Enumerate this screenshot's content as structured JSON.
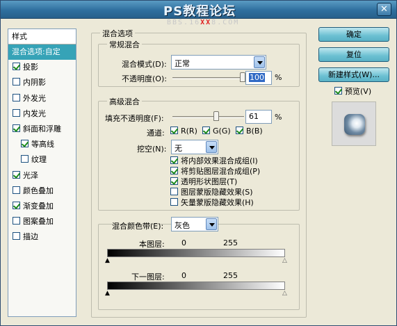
{
  "window": {
    "title": "PS教程论坛",
    "subtitle_pre": "BBS.16",
    "subtitle_red": "XX",
    "subtitle_post": "8.COM",
    "close": "✕"
  },
  "styles": {
    "header": "样式",
    "items": [
      {
        "label": "混合选项:自定",
        "checkbox": false,
        "checked": false,
        "selected": true,
        "indent": false
      },
      {
        "label": "投影",
        "checkbox": true,
        "checked": true,
        "indent": false
      },
      {
        "label": "内阴影",
        "checkbox": true,
        "checked": false,
        "indent": false
      },
      {
        "label": "外发光",
        "checkbox": true,
        "checked": false,
        "indent": false
      },
      {
        "label": "内发光",
        "checkbox": true,
        "checked": false,
        "indent": false
      },
      {
        "label": "斜面和浮雕",
        "checkbox": true,
        "checked": true,
        "indent": false
      },
      {
        "label": "等高线",
        "checkbox": true,
        "checked": true,
        "indent": true
      },
      {
        "label": "纹理",
        "checkbox": true,
        "checked": false,
        "indent": true
      },
      {
        "label": "光泽",
        "checkbox": true,
        "checked": true,
        "indent": false
      },
      {
        "label": "颜色叠加",
        "checkbox": true,
        "checked": false,
        "indent": false
      },
      {
        "label": "渐变叠加",
        "checkbox": true,
        "checked": true,
        "indent": false
      },
      {
        "label": "图案叠加",
        "checkbox": true,
        "checked": false,
        "indent": false
      },
      {
        "label": "描边",
        "checkbox": true,
        "checked": false,
        "indent": false
      }
    ]
  },
  "blend_options": {
    "title": "混合选项",
    "general": {
      "title": "常规混合",
      "mode_label": "混合模式(D):",
      "mode_value": "正常",
      "opacity_label": "不透明度(O):",
      "opacity_value": "100",
      "opacity_unit": "%",
      "opacity_level": 1.0
    },
    "advanced": {
      "title": "高级混合",
      "fill_label": "填充不透明度(F):",
      "fill_value": "61",
      "fill_unit": "%",
      "fill_level": 0.61,
      "channels_label": "通道:",
      "channels": [
        {
          "label": "R(R)",
          "checked": true
        },
        {
          "label": "G(G)",
          "checked": true
        },
        {
          "label": "B(B)",
          "checked": true
        }
      ],
      "knockout_label": "挖空(N):",
      "knockout_value": "无",
      "options": [
        {
          "label": "将内部效果混合成组(I)",
          "checked": true
        },
        {
          "label": "将剪贴图层混合成组(P)",
          "checked": true
        },
        {
          "label": "透明形状图层(T)",
          "checked": true
        },
        {
          "label": "图层蒙版隐藏效果(S)",
          "checked": false
        },
        {
          "label": "矢量蒙版隐藏效果(H)",
          "checked": false
        }
      ]
    },
    "blend_if": {
      "label": "混合颜色带(E):",
      "value": "灰色",
      "this_layer_label": "本图层:",
      "this_layer_low": "0",
      "this_layer_high": "255",
      "underlying_label": "下一图层:",
      "underlying_low": "0",
      "underlying_high": "255"
    }
  },
  "buttons": {
    "ok": "确定",
    "reset": "复位",
    "new_style": "新建样式(W)...",
    "preview_label": "预览(V)",
    "preview_checked": true
  }
}
